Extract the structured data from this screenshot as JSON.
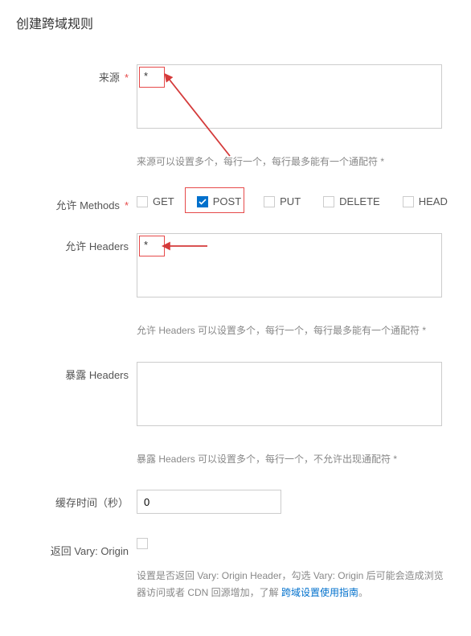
{
  "title": "创建跨域规则",
  "labels": {
    "source": "来源",
    "methods": "允许 Methods",
    "allow_headers": "允许 Headers",
    "expose_headers": "暴露 Headers",
    "cache_time": "缓存时间（秒）",
    "vary_origin": "返回 Vary: Origin"
  },
  "required_mark": "*",
  "values": {
    "source": "*",
    "allow_headers": "*",
    "expose_headers": "",
    "cache_time": "0",
    "vary_origin_checked": false
  },
  "methods": {
    "get": {
      "label": "GET",
      "checked": false
    },
    "post": {
      "label": "POST",
      "checked": true
    },
    "put": {
      "label": "PUT",
      "checked": false
    },
    "delete": {
      "label": "DELETE",
      "checked": false
    },
    "head": {
      "label": "HEAD",
      "checked": false
    }
  },
  "help": {
    "source": "来源可以设置多个，每行一个，每行最多能有一个通配符 *",
    "allow_headers": "允许 Headers 可以设置多个，每行一个，每行最多能有一个通配符 *",
    "expose_headers": "暴露 Headers 可以设置多个，每行一个，不允许出现通配符 *",
    "vary_origin_prefix": "设置是否返回 Vary: Origin Header，勾选 Vary: Origin 后可能会造成浏览器访问或者 CDN 回源增加，了解 ",
    "vary_origin_link": "跨域设置使用指南",
    "vary_origin_suffix": "。"
  }
}
